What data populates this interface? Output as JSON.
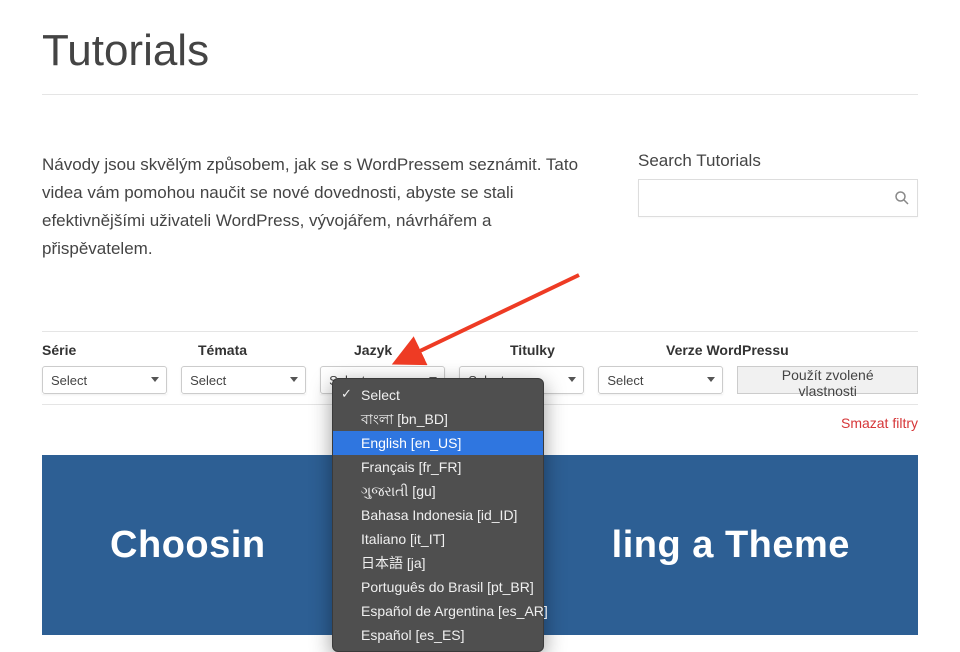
{
  "page": {
    "title": "Tutorials"
  },
  "intro": {
    "text": "Návody jsou skvělým způsobem, jak se s WordPressem seznámit. Tato videa vám pomohou naučit se nové dovednosti, abyste se stali efektivnějšími uživateli WordPress, vývojářem, návrhářem a přispěvatelem."
  },
  "search": {
    "label": "Search Tutorials",
    "placeholder": ""
  },
  "filters": {
    "labels": {
      "series": "Série",
      "topics": "Témata",
      "language": "Jazyk",
      "captions": "Titulky",
      "wp_version": "Verze WordPressu"
    },
    "placeholder": "Select",
    "apply": "Použít zvolené vlastnosti",
    "clear": "Smazat filtry"
  },
  "language_dropdown": {
    "selected": "Select",
    "highlighted": "English [en_US]",
    "options": [
      "Select",
      "বাংলা [bn_BD]",
      "English [en_US]",
      "Français [fr_FR]",
      "ગુજરાતી [gu]",
      "Bahasa Indonesia [id_ID]",
      "Italiano [it_IT]",
      "日本語 [ja]",
      "Português do Brasil [pt_BR]",
      "Español de Argentina [es_AR]",
      "Español [es_ES]"
    ]
  },
  "hero": {
    "title_visible_left": "Choosin",
    "title_visible_right": "ling a Theme"
  },
  "colors": {
    "accent_blue": "#2d5f94",
    "highlight_blue": "#2f76e0",
    "danger": "#d63638",
    "arrow": "#ee3b24"
  }
}
